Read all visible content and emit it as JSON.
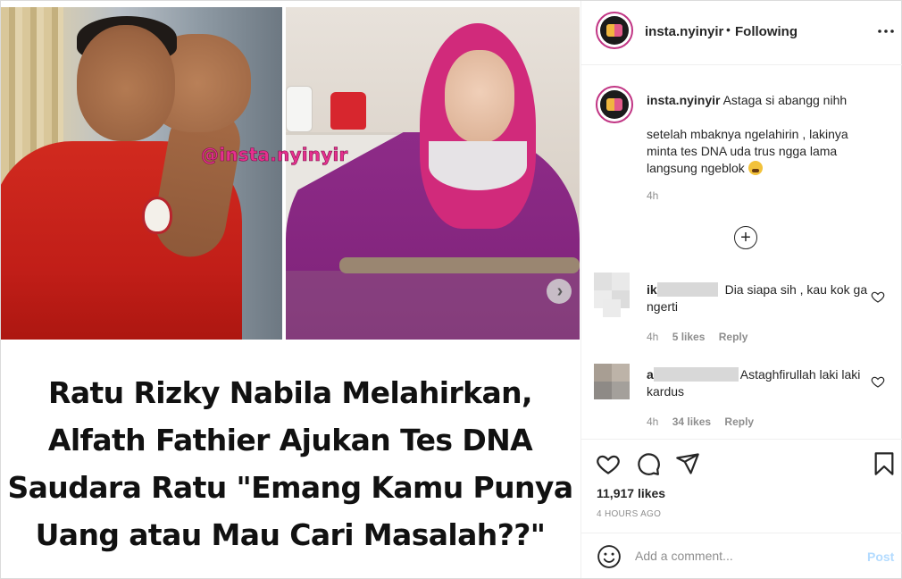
{
  "post": {
    "username": "insta.nyinyir",
    "separator": "•",
    "follow_status": "Following",
    "watermark": "@insta.nyinyir",
    "headline": [
      "Ratu Rizky Nabila Melahirkan,",
      "Alfath Fathier Ajukan Tes DNA",
      "Saudara Ratu \"Emang Kamu Punya",
      "Uang atau Mau Cari Masalah??\""
    ]
  },
  "caption": {
    "username": "insta.nyinyir",
    "first_line": "Astaga si abangg nihh",
    "body": "setelah mbaknya ngelahirin , lakinya minta tes DNA uda trus ngga lama langsung ngeblok",
    "emoji": "weary-face-emoji",
    "time": "4h"
  },
  "comments": [
    {
      "username_visible": "ik",
      "text": "Dia siapa sih , kau kok ga ngerti",
      "time": "4h",
      "likes": "5 likes",
      "reply": "Reply"
    },
    {
      "username_visible": "a",
      "text": "Astaghfirullah laki laki kardus",
      "time": "4h",
      "likes": "34 likes",
      "reply": "Reply"
    }
  ],
  "actions": {
    "likes_count": "11,917 likes",
    "time_ago": "4 HOURS AGO"
  },
  "add_comment": {
    "placeholder": "Add a comment...",
    "post_label": "Post"
  },
  "colors": {
    "accent_link": "#b3dbff",
    "muted_text": "#8e8e8e",
    "avatar_ring": "#c13584"
  }
}
